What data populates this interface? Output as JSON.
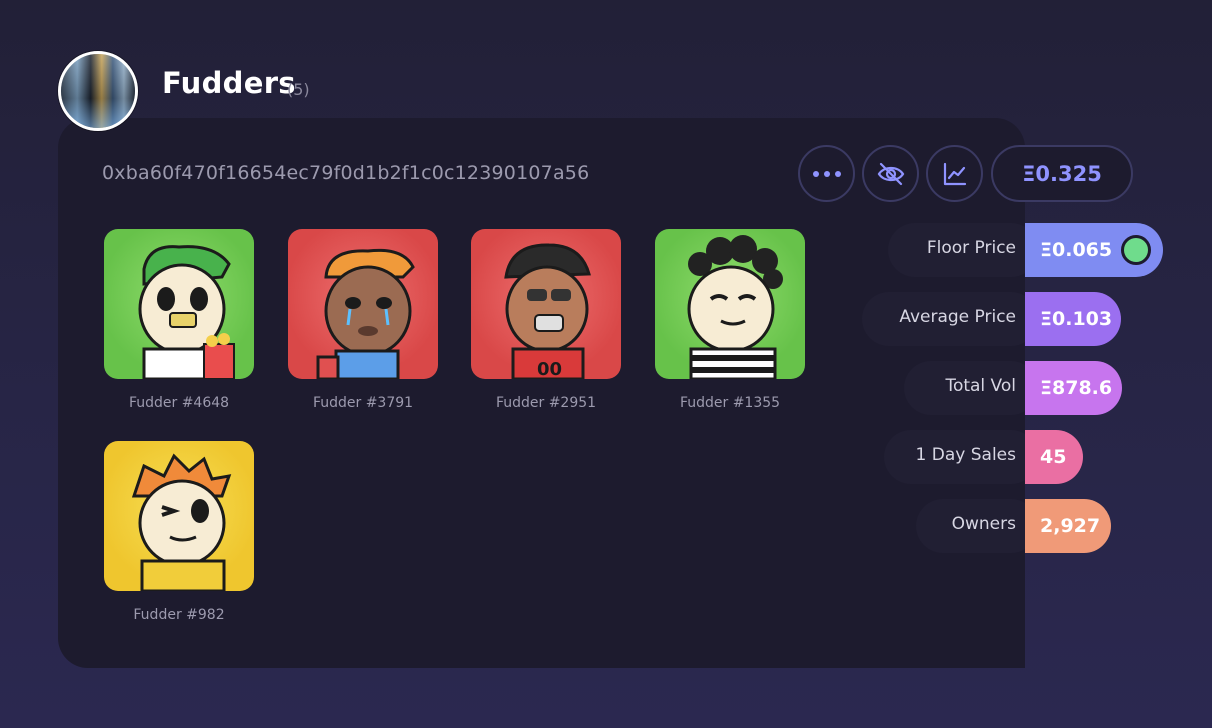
{
  "collection": {
    "name": "Fudders",
    "count": "(5)",
    "address": "0xba60f470f16654ec79f0d1b2f1c0c12390107a56"
  },
  "toolbar": {
    "price": "Ξ0.325"
  },
  "nfts": [
    {
      "label": "Fudder #4648",
      "bg": "green"
    },
    {
      "label": "Fudder #3791",
      "bg": "red"
    },
    {
      "label": "Fudder #2951",
      "bg": "red"
    },
    {
      "label": "Fudder #1355",
      "bg": "green"
    },
    {
      "label": "Fudder #982",
      "bg": "yellow"
    }
  ],
  "stats": [
    {
      "name": "Floor Price",
      "value": "Ξ0.065",
      "color": "#7f8cf2"
    },
    {
      "name": "Average Price",
      "value": "Ξ0.103",
      "color": "#9b6ff0"
    },
    {
      "name": "Total Vol",
      "value": "Ξ878.6",
      "color": "#c775ee"
    },
    {
      "name": "1 Day Sales",
      "value": "45",
      "color": "#ea6fa3"
    },
    {
      "name": "Owners",
      "value": "2,927",
      "color": "#f09a78"
    }
  ],
  "colors": {
    "accent": "#8f93ff",
    "toggle_on": "#6fdc8c"
  }
}
